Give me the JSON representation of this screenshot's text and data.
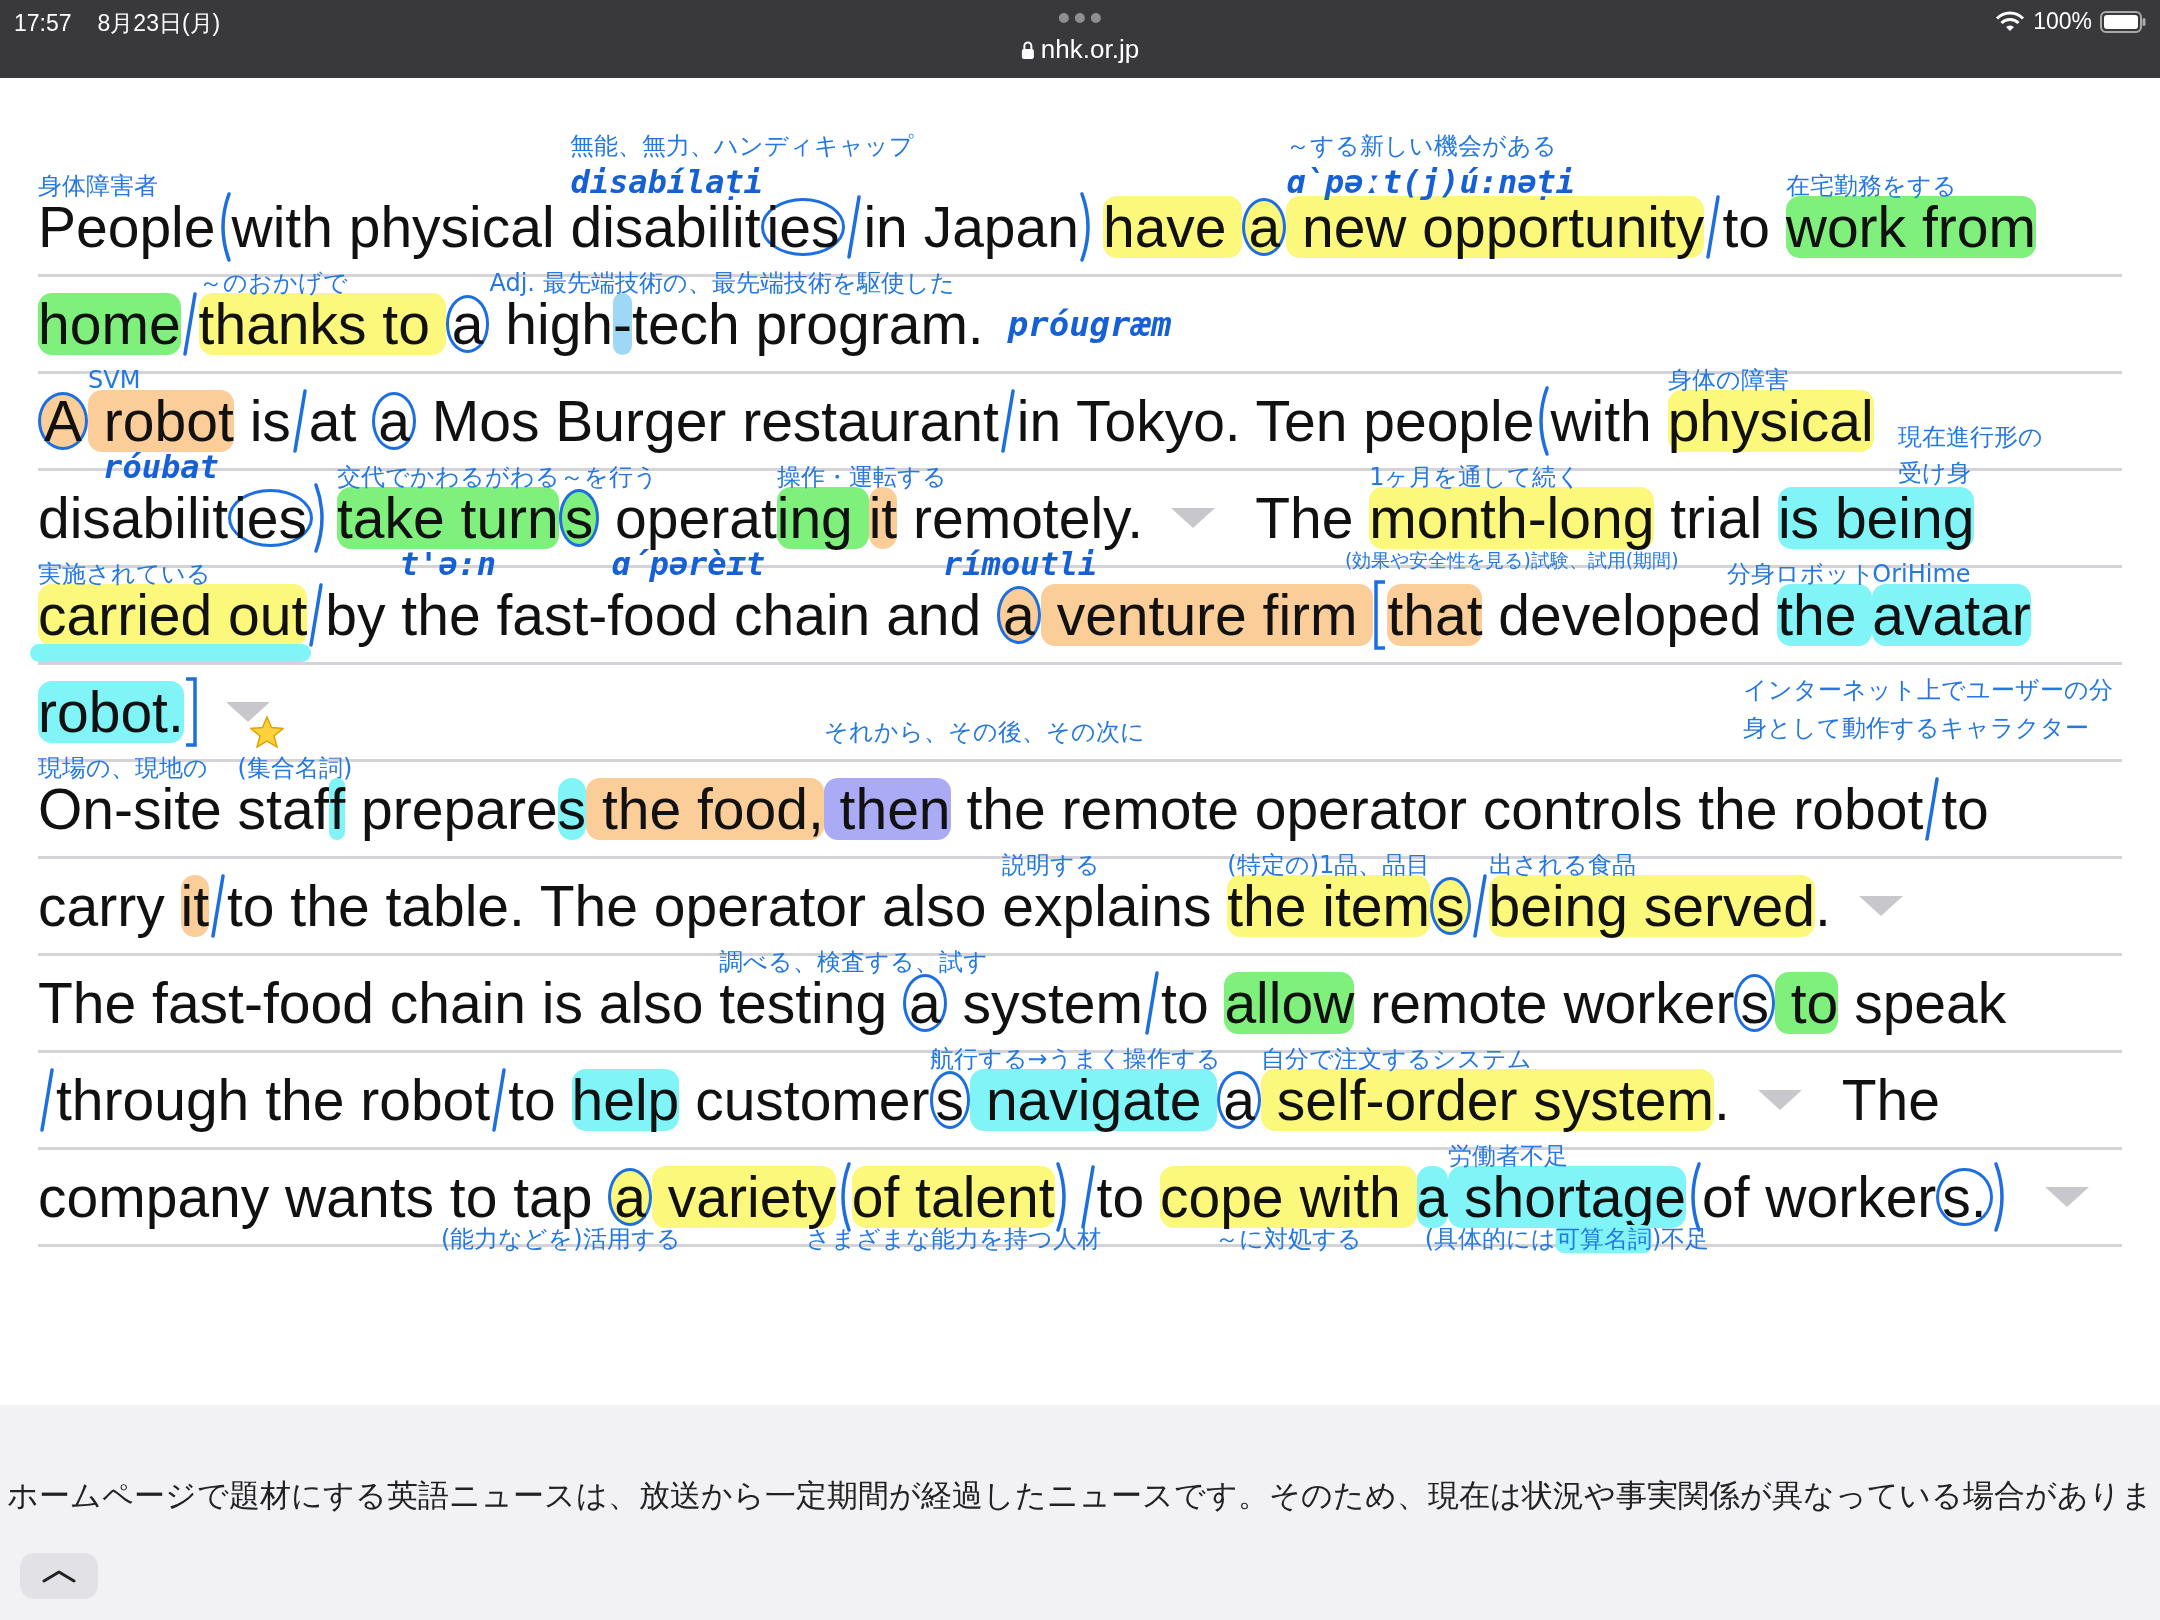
{
  "status_bar": {
    "time": "17:57",
    "date": "8月23日(月)",
    "url": "nhk.or.jp",
    "battery": "100%"
  },
  "lines": [
    {
      "segments": [
        {
          "kind": "text",
          "text": "People",
          "notes_above": [
            {
              "kind": "gloss",
              "text": "身体障害者"
            }
          ]
        },
        {
          "kind": "paren_open"
        },
        {
          "kind": "text",
          "text": "with physical "
        },
        {
          "kind": "text",
          "text": "disabilit",
          "notes_above": [
            {
              "kind": "gloss",
              "text": "無能、無力、ハンディキャップ"
            },
            {
              "kind": "phonetic",
              "text": "disabílaṭi"
            }
          ]
        },
        {
          "kind": "circled",
          "text": "ies"
        },
        {
          "kind": "slash"
        },
        {
          "kind": "text",
          "text": "in Japan"
        },
        {
          "kind": "paren_close"
        },
        {
          "kind": "text",
          "text": "have ",
          "color": "#fbf87c"
        },
        {
          "kind": "circled",
          "text": "a",
          "color": "#fbf87c"
        },
        {
          "kind": "text",
          "text": " new opportunity",
          "color": "#fbf87c",
          "notes_above": [
            {
              "kind": "gloss",
              "text": "～する新しい機会がある"
            },
            {
              "kind": "phonetic",
              "text": "ɑ̀pəːt(j)ú:nəṭi"
            }
          ]
        },
        {
          "kind": "slash"
        },
        {
          "kind": "text",
          "text": "to "
        },
        {
          "kind": "text",
          "text": "work from",
          "color": "#80f07c",
          "notes_above": [
            {
              "kind": "gloss",
              "text": "在宅勤務をする"
            }
          ]
        }
      ]
    },
    {
      "segments": [
        {
          "kind": "text",
          "text": "home",
          "color": "#80f07c"
        },
        {
          "kind": "slash"
        },
        {
          "kind": "text",
          "text": "thanks to ",
          "color": "#fbf87c",
          "notes_above": [
            {
              "kind": "gloss",
              "text": "～のおかげで"
            }
          ]
        },
        {
          "kind": "circled",
          "text": "a"
        },
        {
          "kind": "text",
          "text": " high",
          "notes_above": [
            {
              "kind": "gloss",
              "text": "Adj. 最先端技術の、最先端技術を駆使した"
            }
          ]
        },
        {
          "kind": "text",
          "text": "-",
          "color": "#9fd8f7"
        },
        {
          "kind": "text",
          "text": "tech program."
        },
        {
          "kind": "phonetic",
          "text": "próugræm"
        }
      ]
    },
    {
      "segments": [
        {
          "kind": "circled",
          "text": "A",
          "color": "#fbcd98"
        },
        {
          "kind": "text",
          "text": " robot",
          "color": "#fbcd98",
          "notes_above": [
            {
              "kind": "gloss",
              "text": "SVM"
            }
          ],
          "notes_below": [
            {
              "kind": "phonetic",
              "text": "róubat"
            }
          ]
        },
        {
          "kind": "text",
          "text": " is"
        },
        {
          "kind": "slash"
        },
        {
          "kind": "text",
          "text": "at "
        },
        {
          "kind": "circled",
          "text": "a"
        },
        {
          "kind": "text",
          "text": " Mos Burger restaurant"
        },
        {
          "kind": "slash"
        },
        {
          "kind": "text",
          "text": "in Tokyo. Ten people"
        },
        {
          "kind": "paren_open"
        },
        {
          "kind": "text",
          "text": "with "
        },
        {
          "kind": "text",
          "text": "physical",
          "color": "#fbf87c",
          "notes_above": [
            {
              "kind": "gloss",
              "text": "身体の障害"
            }
          ]
        }
      ]
    },
    {
      "segments": [
        {
          "kind": "text",
          "text": "disabilit"
        },
        {
          "kind": "circled",
          "text": "ies"
        },
        {
          "kind": "paren_close"
        },
        {
          "kind": "text",
          "text": "take turn",
          "color": "#80f07c",
          "notes_above": [
            {
              "kind": "gloss",
              "text": "交代でかわるがわる～を行う"
            }
          ],
          "notes_below": [
            {
              "kind": "phonetic",
              "text": "t'ə:n"
            }
          ]
        },
        {
          "kind": "circled",
          "text": "s",
          "color": "#80f07c"
        },
        {
          "kind": "text",
          "text": " operat",
          "notes_below": [
            {
              "kind": "phonetic",
              "text": "ɑ́pərèɪt"
            }
          ]
        },
        {
          "kind": "text",
          "text": "ing ",
          "color": "#80f07c",
          "notes_above": [
            {
              "kind": "gloss",
              "text": "操作・運転する"
            }
          ]
        },
        {
          "kind": "text",
          "text": "it",
          "color": "#fbcd98"
        },
        {
          "kind": "text",
          "text": " remotely.",
          "notes_below": [
            {
              "kind": "phonetic",
              "text": "rímoutli"
            }
          ]
        },
        {
          "kind": "triangle"
        },
        {
          "kind": "text",
          "text": "The "
        },
        {
          "kind": "text",
          "text": "month-long",
          "color": "#fbf87c",
          "notes_above": [
            {
              "kind": "gloss",
              "text": "1ヶ月を通して続く"
            }
          ],
          "notes_below": [
            {
              "kind": "small_gloss",
              "text": "(効果や安全性を見る)試験、試用(期間)"
            }
          ]
        },
        {
          "kind": "text",
          "text": " trial "
        },
        {
          "kind": "text",
          "text": "is being",
          "color": "#80f4f7",
          "notes_above": [
            {
              "kind": "narrow_gloss",
              "text": "現在進行形の受け身"
            }
          ]
        }
      ]
    },
    {
      "segments": [
        {
          "kind": "text",
          "text": "carried out",
          "color": "#fbf87c",
          "underline": {
            "color": "#80f4f7"
          },
          "notes_above": [
            {
              "kind": "gloss",
              "text": "実施されている"
            }
          ]
        },
        {
          "kind": "slash"
        },
        {
          "kind": "text",
          "text": "by the fast-food chain and "
        },
        {
          "kind": "circled",
          "text": "a",
          "color": "#fbcd98"
        },
        {
          "kind": "text",
          "text": " venture firm ",
          "color": "#fbcd98"
        },
        {
          "kind": "bracket_open"
        },
        {
          "kind": "text",
          "text": "that",
          "color": "#fbcd98"
        },
        {
          "kind": "text",
          "text": " developed "
        },
        {
          "kind": "text",
          "text": "the ",
          "color": "#80f4f7",
          "notes_above": [
            {
              "kind": "left_gloss",
              "text": "分身ロボット"
            }
          ]
        },
        {
          "kind": "text",
          "text": "avatar",
          "color": "#80f4f7",
          "notes_above": [
            {
              "kind": "right_gloss",
              "text": "OriHime"
            }
          ]
        }
      ]
    },
    {
      "segments": [
        {
          "kind": "text",
          "text": "robot.",
          "color": "#80f4f7"
        },
        {
          "kind": "bracket_close"
        },
        {
          "kind": "triangle"
        },
        {
          "kind": "star"
        }
      ],
      "margin_note": "インターネット上でユーザーの分身として動作するキャラクター"
    },
    {
      "segments": [
        {
          "kind": "text",
          "text": "On-site ",
          "notes_above": [
            {
              "kind": "gloss",
              "text": "現場の、現地の"
            }
          ]
        },
        {
          "kind": "text",
          "text": "staf",
          "notes_above": [
            {
              "kind": "gloss",
              "text": "(集合名詞)"
            }
          ]
        },
        {
          "kind": "text",
          "text": "f",
          "color": "#80f4f7"
        },
        {
          "kind": "text",
          "text": " prepare"
        },
        {
          "kind": "text",
          "text": "s",
          "color": "#80f4f7"
        },
        {
          "kind": "text",
          "text": " the food,",
          "color": "#fbcd98"
        },
        {
          "kind": "text",
          "text": " then",
          "color": "#aaaaf5",
          "notes_above": [
            {
              "kind": "high_gloss",
              "text": "それから、その後、その次に"
            }
          ]
        },
        {
          "kind": "text",
          "text": " the remote operator controls the robot"
        },
        {
          "kind": "slash"
        },
        {
          "kind": "text",
          "text": "to"
        }
      ]
    },
    {
      "segments": [
        {
          "kind": "text",
          "text": "carry "
        },
        {
          "kind": "text",
          "text": "it",
          "color": "#fbcd98"
        },
        {
          "kind": "slash"
        },
        {
          "kind": "text",
          "text": "to the table. The operator also "
        },
        {
          "kind": "text",
          "text": "explains ",
          "notes_above": [
            {
              "kind": "gloss",
              "text": "説明する"
            }
          ]
        },
        {
          "kind": "text",
          "text": "the item",
          "color": "#fbf87c",
          "notes_above": [
            {
              "kind": "gloss",
              "text": "(特定の)1品、品目"
            }
          ]
        },
        {
          "kind": "circled",
          "text": "s",
          "color": "#fbf87c"
        },
        {
          "kind": "slash"
        },
        {
          "kind": "text",
          "text": "being served",
          "color": "#fbf87c",
          "notes_above": [
            {
              "kind": "gloss",
              "text": "出される食品"
            }
          ]
        },
        {
          "kind": "text",
          "text": "."
        },
        {
          "kind": "triangle"
        }
      ]
    },
    {
      "segments": [
        {
          "kind": "text",
          "text": "The fast-food chain is also "
        },
        {
          "kind": "text",
          "text": "testing ",
          "notes_above": [
            {
              "kind": "gloss",
              "text": "調べる、検査する、試す"
            }
          ]
        },
        {
          "kind": "circled",
          "text": "a"
        },
        {
          "kind": "text",
          "text": " system"
        },
        {
          "kind": "slash"
        },
        {
          "kind": "text",
          "text": "to "
        },
        {
          "kind": "text",
          "text": "allow",
          "color": "#80f07c"
        },
        {
          "kind": "text",
          "text": " remote worker"
        },
        {
          "kind": "circled",
          "text": "s"
        },
        {
          "kind": "text",
          "text": " to",
          "color": "#80f07c"
        },
        {
          "kind": "text",
          "text": " speak"
        }
      ]
    },
    {
      "segments": [
        {
          "kind": "slash"
        },
        {
          "kind": "text",
          "text": "through the robot"
        },
        {
          "kind": "slash"
        },
        {
          "kind": "text",
          "text": "to "
        },
        {
          "kind": "text",
          "text": "help",
          "color": "#80f4f7"
        },
        {
          "kind": "text",
          "text": " customer"
        },
        {
          "kind": "circled",
          "text": "s",
          "notes_above": [
            {
              "kind": "gloss",
              "text": "航行する→うまく操作する"
            }
          ]
        },
        {
          "kind": "text",
          "text": " navigate ",
          "color": "#80f4f7"
        },
        {
          "kind": "circled",
          "text": "a"
        },
        {
          "kind": "text",
          "text": " self-order system",
          "color": "#fbf87c",
          "notes_above": [
            {
              "kind": "gloss",
              "text": "自分で注文するシステム"
            }
          ]
        },
        {
          "kind": "text",
          "text": "."
        },
        {
          "kind": "triangle"
        },
        {
          "kind": "text",
          "text": "The"
        }
      ]
    },
    {
      "segments": [
        {
          "kind": "text",
          "text": "company wants to "
        },
        {
          "kind": "text",
          "text": "tap ",
          "notes_below": [
            {
              "kind": "gloss",
              "text": "(能力などを)活用する"
            }
          ]
        },
        {
          "kind": "circled",
          "text": "a",
          "color": "#fbf87c"
        },
        {
          "kind": "text",
          "text": " variety",
          "color": "#fbf87c"
        },
        {
          "kind": "paren_open"
        },
        {
          "kind": "text",
          "text": "of talent",
          "color": "#fbf87c",
          "notes_below": [
            {
              "kind": "gloss",
              "text": "さまざまな能力を持つ人材"
            }
          ]
        },
        {
          "kind": "paren_close"
        },
        {
          "kind": "slash"
        },
        {
          "kind": "text",
          "text": "to "
        },
        {
          "kind": "text",
          "text": "cope with ",
          "color": "#fbf87c",
          "notes_below": [
            {
              "kind": "gloss",
              "text": "～に対処する"
            }
          ]
        },
        {
          "kind": "text",
          "text": "a",
          "color": "#80f4f7"
        },
        {
          "kind": "text",
          "text": " shortage",
          "color": "#80f4f7",
          "notes_above": [
            {
              "kind": "gloss",
              "text": "労働者不足"
            }
          ],
          "notes_below": [
            {
              "kind": "gloss",
              "parts": [
                {
                  "text": "(具体的には"
                },
                {
                  "text": "可算名詞",
                  "color": "#80f4f7"
                },
                {
                  "text": ")不足"
                }
              ]
            }
          ]
        },
        {
          "kind": "paren_open"
        },
        {
          "kind": "text",
          "text": "of worker"
        },
        {
          "kind": "circled",
          "text": "s."
        },
        {
          "kind": "paren_close"
        },
        {
          "kind": "triangle"
        }
      ]
    }
  ],
  "footer": {
    "notice": "ホームページで題材にする英語ニュースは、放送から一定期間が経過したニュースです。そのため、現在は状況や事実関係が異なっている場合がありま"
  }
}
